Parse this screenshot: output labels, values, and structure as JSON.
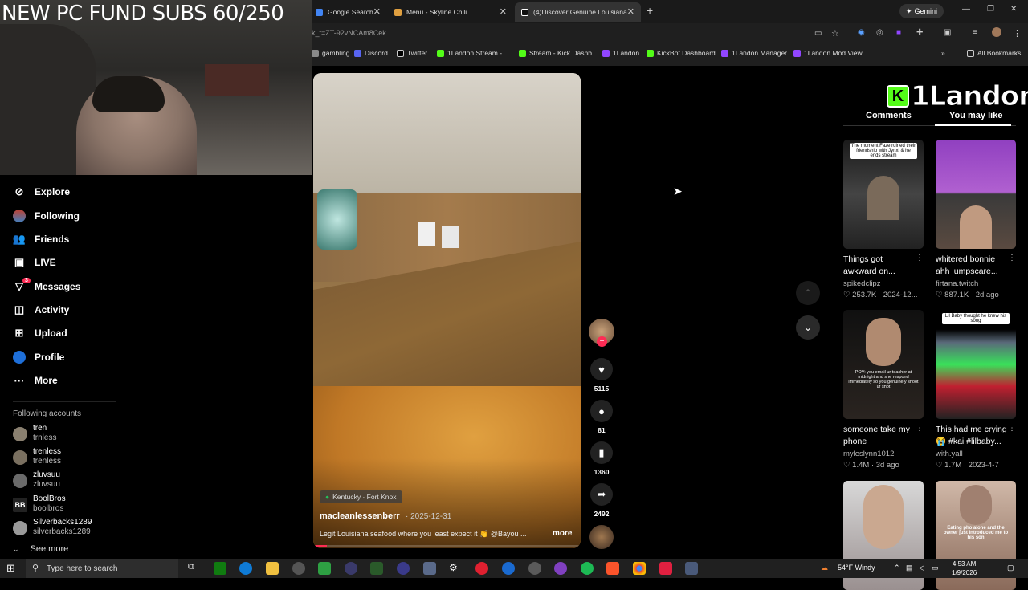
{
  "stream_overlay": {
    "title": "NEW PC FUND SUBS 60/250"
  },
  "browser": {
    "tabs": [
      {
        "label": "Google Search",
        "color": "#4285f4"
      },
      {
        "label": "Menu - Skyline Chili",
        "color": "#e0a040"
      },
      {
        "label": "(4)Discover Genuine Louisiana",
        "color": "#000000"
      }
    ],
    "gemini_label": "Gemini",
    "url": "k_t=ZT-92vNCAm8Cek",
    "bookmarks": [
      {
        "label": "gambling",
        "color": "#8a8a8a"
      },
      {
        "label": "Discord",
        "color": "#5865f2"
      },
      {
        "label": "Twitter",
        "color": "#000000"
      },
      {
        "label": "1Landon Stream -...",
        "color": "#53fc18"
      },
      {
        "label": "Stream - Kick Dashb...",
        "color": "#53fc18"
      },
      {
        "label": "1Landon",
        "color": "#9146ff"
      },
      {
        "label": "KickBot Dashboard",
        "color": "#53fc18"
      },
      {
        "label": "1Landon Manager",
        "color": "#9146ff"
      },
      {
        "label": "1Landon Mod View",
        "color": "#9146ff"
      }
    ],
    "all_bookmarks": "All Bookmarks"
  },
  "nav": {
    "items": [
      {
        "label": "Explore",
        "icon": "compass-icon"
      },
      {
        "label": "Following",
        "icon": "following-avatar-icon"
      },
      {
        "label": "Friends",
        "icon": "friends-icon"
      },
      {
        "label": "LIVE",
        "icon": "live-icon"
      },
      {
        "label": "Messages",
        "icon": "messages-icon",
        "badge": "3"
      },
      {
        "label": "Activity",
        "icon": "activity-icon"
      },
      {
        "label": "Upload",
        "icon": "upload-icon"
      },
      {
        "label": "Profile",
        "icon": "profile-icon"
      },
      {
        "label": "More",
        "icon": "more-icon"
      }
    ],
    "following_accounts_label": "Following accounts",
    "accounts": [
      {
        "name": "tren",
        "handle": "trnless"
      },
      {
        "name": "trenless",
        "handle": "trenless"
      },
      {
        "name": "zluvsuu",
        "handle": "zluvsuu"
      },
      {
        "name": "BoolBros",
        "handle": "boolbros"
      },
      {
        "name": "Silverbacks1289",
        "handle": "silverbacks1289"
      }
    ],
    "see_more": "See more"
  },
  "video": {
    "location": "Kentucky · Fort Knox",
    "author": "macleanlessenberr",
    "date": "· 2025-12-31",
    "caption": "Legit Louisiana seafood where you least expect it 👏 @Bayou ...",
    "more_label": "more",
    "progress": 0.05,
    "likes": "5115",
    "comments": "81",
    "saves": "1360",
    "shares": "2492"
  },
  "right": {
    "logo_text": "1Landon",
    "tab_comments": "Comments",
    "tab_you_may_like": "You may like",
    "cards": [
      {
        "title": "Things got awkward on...",
        "author": "spikedclipz",
        "meta": "♡ 253.7K · 2024-12...",
        "overlay": "The moment Faze ruined their friendship with Jynxi & he ends stream"
      },
      {
        "title": "whitered bonnie ahh jumpscare...",
        "author": "firtana.twitch",
        "meta": "♡ 887.1K · 2d ago",
        "overlay": ""
      },
      {
        "title": "someone take my phone",
        "author": "myleslynn1012",
        "meta": "♡ 1.4M · 3d ago",
        "overlay": "POV: you email ur teacher at midnight and she respond immediately so you genuinely shoot ur shot"
      },
      {
        "title": "This had me crying 😭 #kai #lilbaby...",
        "author": "with.yall",
        "meta": "♡ 1.7M · 2023-4-7",
        "overlay": "Lil Baby thought he knew his song"
      },
      {
        "title": "",
        "author": "",
        "meta": "",
        "overlay": ""
      },
      {
        "title": "",
        "author": "",
        "meta": "",
        "overlay": "Eating pho alone and the owner just introduced me to his son"
      }
    ]
  },
  "taskbar": {
    "search_placeholder": "Type here to search",
    "weather": "54°F Windy",
    "time": "4:53 AM",
    "date": "1/9/2026"
  }
}
